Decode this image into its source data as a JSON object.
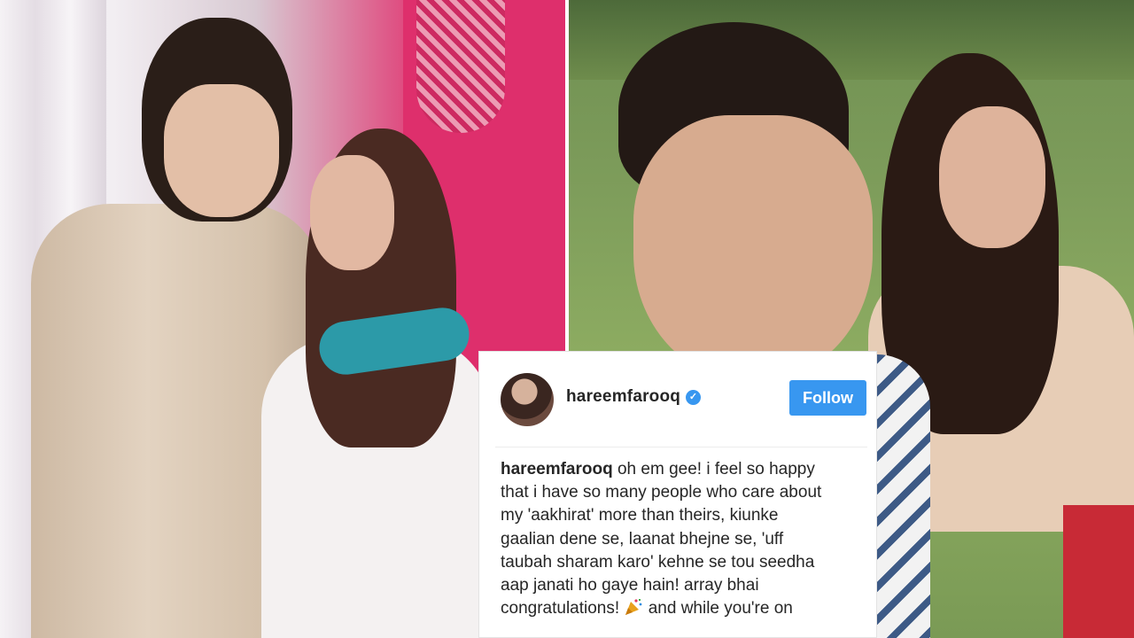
{
  "post": {
    "username": "hareemfarooq",
    "verified_icon": "verified-badge-icon",
    "follow_label": "Follow",
    "caption_username": "hareemfarooq",
    "caption_lines": [
      " oh em gee! i feel so happy",
      "that i have so many people who care about",
      "my 'aakhirat' more than theirs, kiunke",
      "gaalian dene se, laanat bhejne se, 'uff",
      "taubah sharam karo' kehne se tou seedha",
      "aap janati ho gaye hain! array bhai",
      "congratulations!"
    ],
    "caption_after_emoji": " and while you're on",
    "emoji_icon": "party-popper-icon"
  },
  "colors": {
    "follow_button": "#3897f0",
    "username_text": "#262626"
  }
}
